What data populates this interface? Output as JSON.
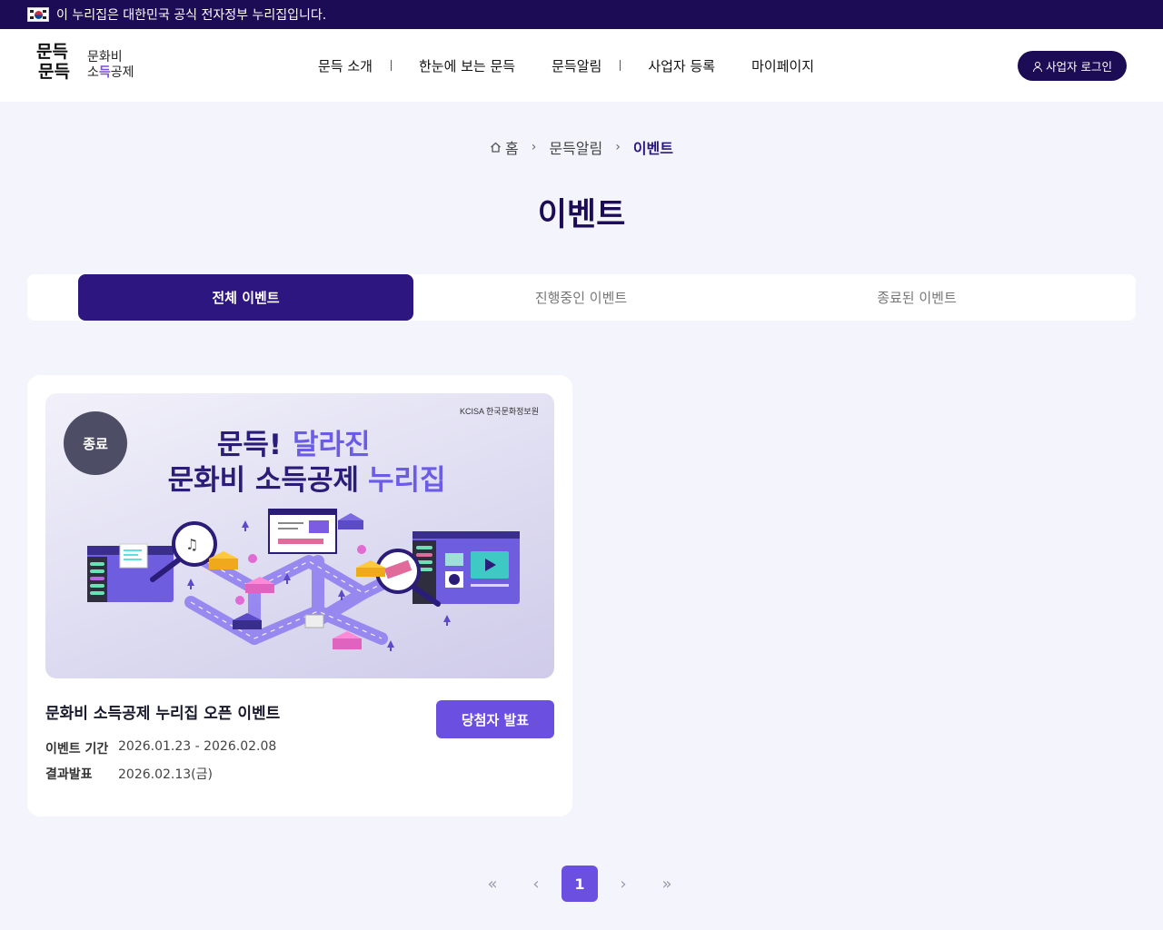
{
  "gov_bar": {
    "text": "이 누리집은 대한민국 공식 전자정부 누리집입니다."
  },
  "logo": {
    "mark_line1": "문득",
    "mark_line2": "문득",
    "name_line1": "문화비",
    "name_line2_pre": "소",
    "name_line2_hl": "득",
    "name_line2_post": "공제"
  },
  "nav": {
    "items": [
      "문득 소개",
      "한눈에 보는 문득",
      "문득알림",
      "사업자 등록",
      "마이페이지"
    ]
  },
  "login": {
    "label": "사업자 로그인"
  },
  "breadcrumb": {
    "home": "홈",
    "level1": "문득알림",
    "current": "이벤트"
  },
  "page": {
    "title": "이벤트"
  },
  "tabs": [
    {
      "label": "전체 이벤트",
      "active": true
    },
    {
      "label": "진행중인 이벤트",
      "active": false
    },
    {
      "label": "종료된 이벤트",
      "active": false
    }
  ],
  "event_card": {
    "status": "종료",
    "thumb": {
      "org": "KCISA 한국문화정보원",
      "headline_line1_a": "문득!",
      "headline_line1_b": "달라진",
      "headline_line2_a": "문화비 소득공제",
      "headline_line2_b": "누리집"
    },
    "title": "문화비 소득공제 누리집 오픈 이벤트",
    "action_label": "당첨자 발표",
    "period_label": "이벤트 기간",
    "period_value": "2026.01.23 - 2026.02.08",
    "result_label": "결과발표",
    "result_value": "2026.02.13(금)"
  },
  "pagination": {
    "first": "«",
    "prev": "‹",
    "current": "1",
    "next": "›",
    "last": "»"
  },
  "colors": {
    "navy": "#1b0c55",
    "accent": "#6a4fe0",
    "tab_active": "#2d1680",
    "bg": "#f4f4fd"
  }
}
